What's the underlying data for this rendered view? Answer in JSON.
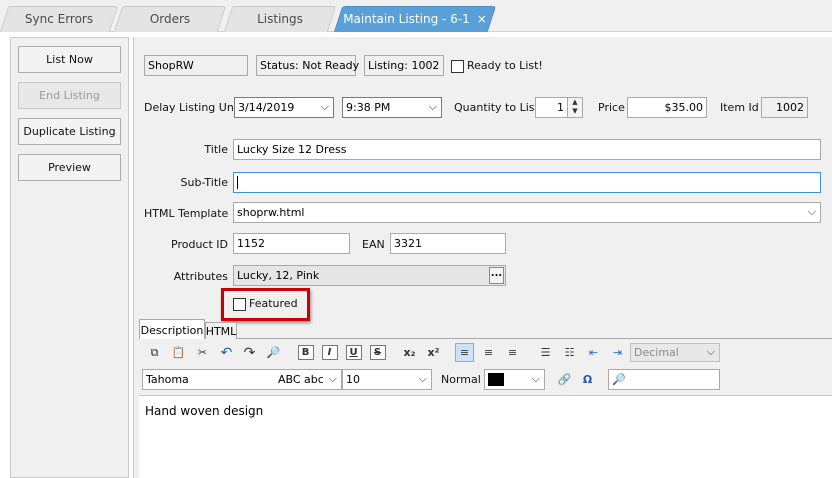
{
  "tabs": [
    {
      "label": "Sync Errors"
    },
    {
      "label": "Orders"
    },
    {
      "label": "Listings"
    },
    {
      "label": "Maintain Listing - 6-1",
      "close": "×"
    }
  ],
  "left_buttons": {
    "list_now": "List Now",
    "end_listing": "End Listing",
    "duplicate": "Duplicate Listing",
    "preview": "Preview"
  },
  "info": {
    "store": "ShopRW",
    "status": "Status: Not Ready",
    "listing": "Listing: 1002",
    "ready_label": "Ready to List!"
  },
  "schedule": {
    "delay_label": "Delay Listing Until",
    "date": "3/14/2019",
    "time": "9:38 PM",
    "qty_label": "Quantity to List",
    "qty": "1",
    "price_label": "Price",
    "price": "$35.00",
    "item_id_label": "Item Id",
    "item_id": "1002"
  },
  "fields": {
    "title_label": "Title",
    "title": "Lucky Size 12 Dress",
    "subtitle_label": "Sub-Title",
    "subtitle": "",
    "template_label": "HTML Template",
    "template": "shoprw.html",
    "product_id_label": "Product ID",
    "product_id": "1152",
    "ean_label": "EAN",
    "ean": "3321",
    "attributes_label": "Attributes",
    "attributes": "Lucky, 12, Pink",
    "attributes_btn": "...",
    "featured_label": "Featured"
  },
  "editor": {
    "tab_description": "Description",
    "tab_html": "HTML",
    "number_format": "Decimal",
    "font": "Tahoma",
    "font_preview": "ABC abc",
    "size": "10",
    "style": "Normal",
    "content": "Hand woven design",
    "highlight_color": "#cc0000",
    "accent": "#5aa0d8"
  }
}
